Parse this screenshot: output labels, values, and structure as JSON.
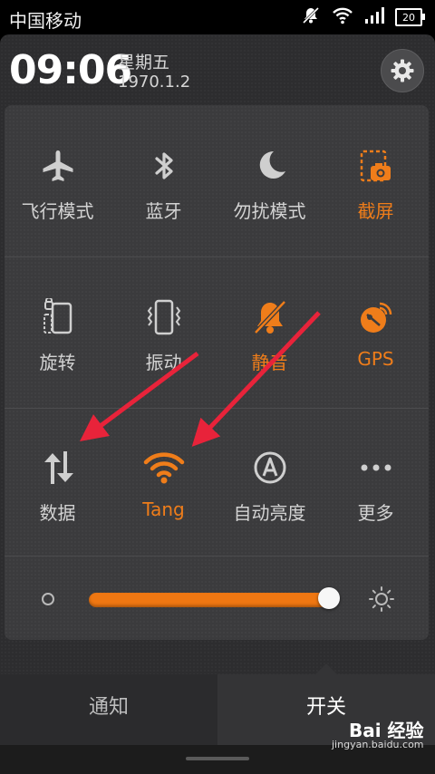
{
  "status_bar": {
    "carrier": "中国移动",
    "battery": "20",
    "icons": [
      "mute-icon",
      "wifi-icon",
      "signal-icon",
      "battery-icon"
    ]
  },
  "header": {
    "time": "09:06",
    "weekday": "星期五",
    "date": "1970.1.2",
    "settings_icon": "gear-icon"
  },
  "toggles": [
    {
      "label": "飞行模式",
      "icon": "airplane-icon",
      "active": false
    },
    {
      "label": "蓝牙",
      "icon": "bluetooth-icon",
      "active": false
    },
    {
      "label": "勿扰模式",
      "icon": "moon-icon",
      "active": false
    },
    {
      "label": "截屏",
      "icon": "screenshot-icon",
      "active": true
    },
    {
      "label": "旋转",
      "icon": "rotate-icon",
      "active": false
    },
    {
      "label": "振动",
      "icon": "vibrate-icon",
      "active": false
    },
    {
      "label": "静音",
      "icon": "mute-bell-icon",
      "active": true
    },
    {
      "label": "GPS",
      "icon": "gps-icon",
      "active": true
    },
    {
      "label": "数据",
      "icon": "data-icon",
      "active": false
    },
    {
      "label": "Tang",
      "icon": "wifi-icon",
      "active": true
    },
    {
      "label": "自动亮度",
      "icon": "auto-brightness-icon",
      "active": false
    },
    {
      "label": "更多",
      "icon": "more-icon",
      "active": false
    }
  ],
  "brightness": {
    "level": 0.98
  },
  "tabs": {
    "notifications": "通知",
    "toggles": "开关"
  },
  "watermark": {
    "brand": "Bai 经验",
    "site": "jingyan.baidu.com"
  },
  "colors": {
    "accent": "#ef7d1a",
    "arrow": "#e8233a",
    "inactive": "#d3d3d3"
  }
}
